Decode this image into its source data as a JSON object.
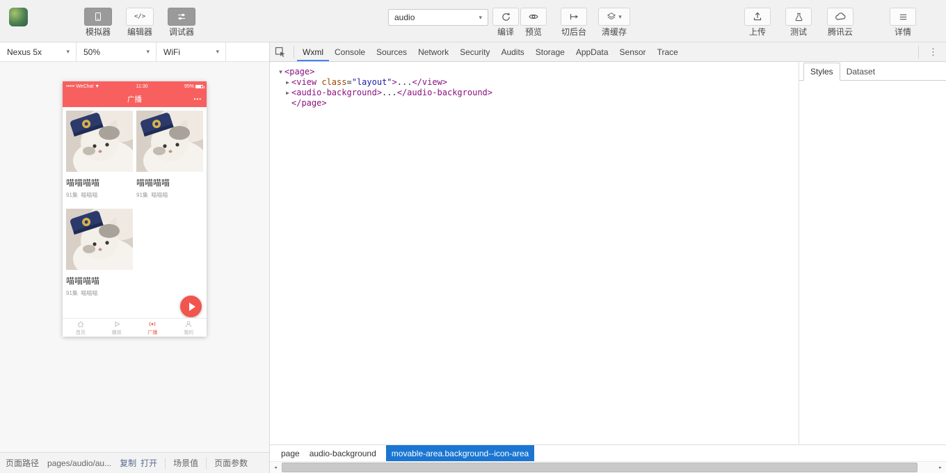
{
  "toolbar": {
    "modes": [
      {
        "label": "模拟器",
        "active": true
      },
      {
        "label": "编辑器",
        "active": false
      },
      {
        "label": "调试器",
        "active": true
      }
    ],
    "scene_select_value": "audio",
    "compile_label": "编译",
    "preview_label": "预览",
    "background_label": "切后台",
    "clear_cache_label": "清缓存",
    "upload_label": "上传",
    "test_label": "测试",
    "cloud_label": "腾讯云",
    "details_label": "详情"
  },
  "simulator": {
    "device": "Nexus 5x",
    "scale": "50%",
    "network": "WiFi"
  },
  "phone": {
    "status_bar": {
      "carrier": "••••• WeChat ▼",
      "time": "11:30",
      "battery": "95%"
    },
    "nav": {
      "title": "广播",
      "more": "•••"
    },
    "cards": [
      {
        "title": "喵喵喵喵",
        "meta": "91集  喵喵喵"
      },
      {
        "title": "喵喵喵喵",
        "meta": "91集  喵喵喵"
      },
      {
        "title": "喵喵喵喵",
        "meta": "91集  喵喵喵"
      }
    ],
    "tabbar": [
      {
        "label": "首页",
        "active": false
      },
      {
        "label": "播放",
        "active": false
      },
      {
        "label": "广播",
        "active": true
      },
      {
        "label": "我的",
        "active": false
      }
    ]
  },
  "devtools": {
    "tabs": [
      "Wxml",
      "Console",
      "Sources",
      "Network",
      "Security",
      "Audits",
      "Storage",
      "AppData",
      "Sensor",
      "Trace"
    ],
    "active_tab": "Wxml",
    "tree": [
      {
        "indent": 0,
        "arrow": "▼",
        "tokens": [
          {
            "c": "tag",
            "t": "<page>"
          }
        ]
      },
      {
        "indent": 1,
        "arrow": "▶",
        "tokens": [
          {
            "c": "tag",
            "t": "<view"
          },
          {
            "c": "attr",
            "t": " class"
          },
          {
            "c": "plain",
            "t": "="
          },
          {
            "c": "val",
            "t": "\"layout\""
          },
          {
            "c": "tag",
            "t": ">"
          },
          {
            "c": "plain",
            "t": "..."
          },
          {
            "c": "tag",
            "t": "</view>"
          }
        ]
      },
      {
        "indent": 1,
        "arrow": "▶",
        "tokens": [
          {
            "c": "tag",
            "t": "<audio-background>"
          },
          {
            "c": "plain",
            "t": "..."
          },
          {
            "c": "tag",
            "t": "</audio-background>"
          }
        ]
      },
      {
        "indent": 1,
        "arrow": "",
        "tokens": [
          {
            "c": "tag",
            "t": "</page>"
          }
        ]
      }
    ],
    "inspector_tabs": [
      {
        "label": "Styles",
        "active": true
      },
      {
        "label": "Dataset",
        "active": false
      }
    ],
    "breadcrumbs": [
      {
        "label": "page",
        "active": false
      },
      {
        "label": "audio-background",
        "active": false
      },
      {
        "label": "movable-area.background--icon-area",
        "active": true
      }
    ]
  },
  "status_bar": {
    "path_label": "页面路径",
    "path_value": "pages/audio/au...",
    "copy_label": "复制",
    "open_label": "打开",
    "scene_label": "场景值",
    "params_label": "页面参数"
  },
  "colors": {
    "phone_accent_red": "#f7605f",
    "fab_red": "#f2544e",
    "breadcrumb_blue": "#1a76d2",
    "tab_underline_blue": "#4285f4",
    "syntax_tag": "#881280",
    "syntax_attr": "#994500",
    "syntax_value": "#1a1aa6"
  }
}
